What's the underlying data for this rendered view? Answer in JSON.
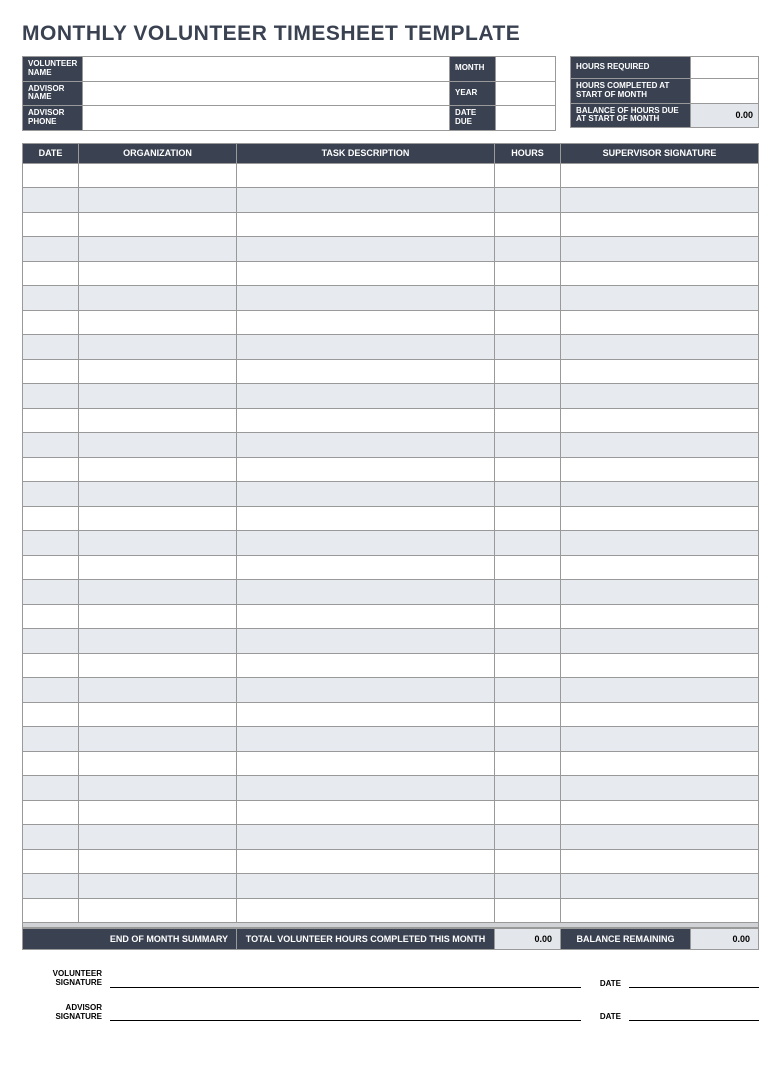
{
  "title": "MONTHLY VOLUNTEER TIMESHEET TEMPLATE",
  "info": {
    "volunteer_name_lbl": "VOLUNTEER NAME",
    "volunteer_name": "",
    "advisor_name_lbl": "ADVISOR NAME",
    "advisor_name": "",
    "advisor_phone_lbl": "ADVISOR PHONE",
    "advisor_phone": "",
    "month_lbl": "MONTH",
    "month": "",
    "year_lbl": "YEAR",
    "year": "",
    "date_due_lbl": "DATE DUE",
    "date_due": "",
    "hours_required_lbl": "HOURS REQUIRED",
    "hours_required": "",
    "hours_completed_lbl": "HOURS COMPLETED AT START OF MONTH",
    "hours_completed": "",
    "balance_due_lbl": "BALANCE OF HOURS DUE AT START OF MONTH",
    "balance_due": "0.00"
  },
  "cols": {
    "date": "DATE",
    "org": "ORGANIZATION",
    "task": "TASK DESCRIPTION",
    "hours": "HOURS",
    "sig": "SUPERVISOR SIGNATURE"
  },
  "row_count": 31,
  "summary": {
    "end_lbl": "END OF MONTH SUMMARY",
    "total_lbl": "TOTAL VOLUNTEER HOURS COMPLETED THIS MONTH",
    "total_val": "0.00",
    "balance_lbl": "BALANCE REMAINING",
    "balance_val": "0.00"
  },
  "sig": {
    "volunteer_lbl": "VOLUNTEER SIGNATURE",
    "advisor_lbl": "ADVISOR SIGNATURE",
    "date_lbl": "DATE"
  }
}
